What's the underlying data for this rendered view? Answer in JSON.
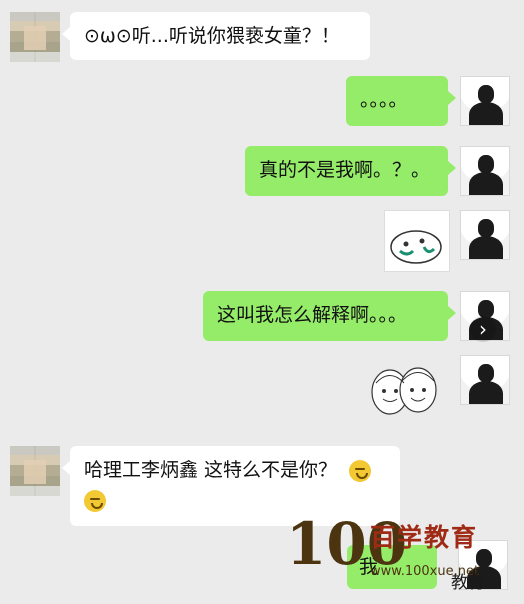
{
  "chat": {
    "messages": [
      {
        "text": "⊙ω⊙听...听说你猥亵女童？！"
      },
      {
        "text": "。。。。"
      },
      {
        "text": "真的不是我啊。？。"
      },
      {
        "text": "这叫我怎么解释啊。。。"
      },
      {
        "text": "哈理工李炳鑫 这特么不是你？"
      },
      {
        "text": "我"
      }
    ]
  },
  "watermark": {
    "logo": "100",
    "brand": "百学教育",
    "url": "www.100xue.net",
    "sub": "教育"
  }
}
